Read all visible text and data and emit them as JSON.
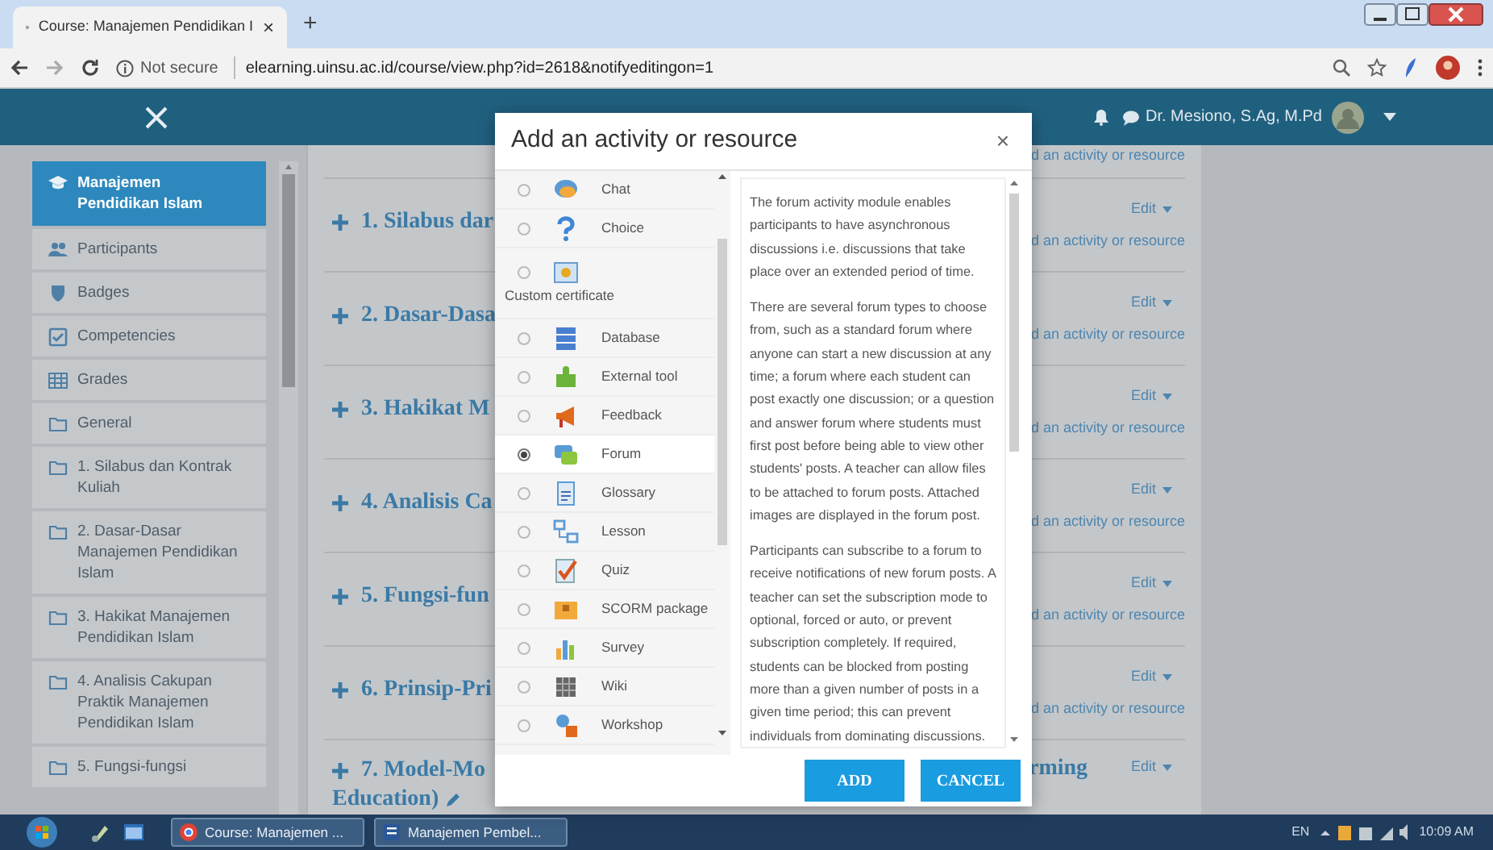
{
  "browser": {
    "tab_title": "Course: Manajemen Pendidikan I",
    "tab_close": "×",
    "new_tab": "+",
    "security": "Not secure",
    "url": "elearning.uinsu.ac.id/course/view.php?id=2618&notifyeditingon=1"
  },
  "navbar": {
    "user_name": "Dr. Mesiono, S.Ag, M.Pd"
  },
  "sidebar": {
    "items": [
      {
        "label": "Manajemen Pendidikan Islam",
        "selected": true
      },
      {
        "label": "Participants",
        "selected": false
      },
      {
        "label": "Badges",
        "selected": false
      },
      {
        "label": "Competencies",
        "selected": false
      },
      {
        "label": "Grades",
        "selected": false
      },
      {
        "label": "General",
        "selected": false
      },
      {
        "label": "1. Silabus dan Kontrak Kuliah",
        "selected": false
      },
      {
        "label": "2. Dasar-Dasar Manajemen Pendidikan Islam",
        "selected": false
      },
      {
        "label": "3. Hakikat Manajemen Pendidikan Islam",
        "selected": false
      },
      {
        "label": "4. Analisis Cakupan Praktik Manajemen Pendidikan Islam",
        "selected": false
      },
      {
        "label": "5. Fungsi-fungsi",
        "selected": false
      }
    ]
  },
  "sections": [
    {
      "add_link": "d an activity or resource"
    },
    {
      "heading": "1. Silabus dar",
      "edit": "Edit",
      "add_link": "d an activity or resource"
    },
    {
      "heading": "2. Dasar-Dasa",
      "edit": "Edit",
      "add_link": "d an activity or resource"
    },
    {
      "heading": "3. Hakikat M",
      "edit": "Edit",
      "add_link": "d an activity or resource"
    },
    {
      "heading": "4. Analisis Ca",
      "edit": "Edit",
      "add_link": "d an activity or resource"
    },
    {
      "heading": "5. Fungsi-fun",
      "edit": "Edit",
      "add_link": "d an activity or resource"
    },
    {
      "heading": "6. Prinsip-Pri",
      "edit": "Edit",
      "add_link": "d an activity or resource"
    },
    {
      "heading": "7. Model-Mo",
      "heading_line2": "Education)",
      "heading_tail": "rming",
      "edit": "Edit"
    }
  ],
  "modal": {
    "title": "Add an activity or resource",
    "close": "×",
    "items": [
      {
        "label": "Chat",
        "kind": "inline",
        "selected": false
      },
      {
        "label": "Choice",
        "kind": "inline",
        "selected": false
      },
      {
        "label": "Custom certificate",
        "kind": "stacked",
        "selected": false
      },
      {
        "label": "Database",
        "kind": "inline",
        "selected": false
      },
      {
        "label": "External tool",
        "kind": "inline",
        "selected": false
      },
      {
        "label": "Feedback",
        "kind": "inline",
        "selected": false
      },
      {
        "label": "Forum",
        "kind": "inline",
        "selected": true
      },
      {
        "label": "Glossary",
        "kind": "inline",
        "selected": false
      },
      {
        "label": "Lesson",
        "kind": "inline",
        "selected": false
      },
      {
        "label": "Quiz",
        "kind": "inline",
        "selected": false
      },
      {
        "label": "SCORM package",
        "kind": "inline",
        "selected": false
      },
      {
        "label": "Survey",
        "kind": "inline",
        "selected": false
      },
      {
        "label": "Wiki",
        "kind": "inline",
        "selected": false
      },
      {
        "label": "Workshop",
        "kind": "inline",
        "selected": false
      }
    ],
    "description": [
      "The forum activity module enables participants to have asynchronous discussions i.e. discussions that take place over an extended period of time.",
      "There are several forum types to choose from, such as a standard forum where anyone can start a new discussion at any time; a forum where each student can post exactly one discussion; or a question and answer forum where students must first post before being able to view other students' posts. A teacher can allow files to be attached to forum posts. Attached images are displayed in the forum post.",
      "Participants can subscribe to a forum to receive notifications of new forum posts. A teacher can set the subscription mode to optional, forced or auto, or prevent subscription completely. If required, students can be blocked from posting more than a given number of posts in a given time period; this can prevent individuals from dominating discussions."
    ],
    "buttons": [
      "ADD",
      "CANCEL"
    ]
  },
  "taskbar": {
    "windows": [
      {
        "label": "Course: Manajemen ..."
      },
      {
        "label": "Manajemen Pembel..."
      }
    ],
    "language": "EN",
    "time": "10:09 AM"
  }
}
